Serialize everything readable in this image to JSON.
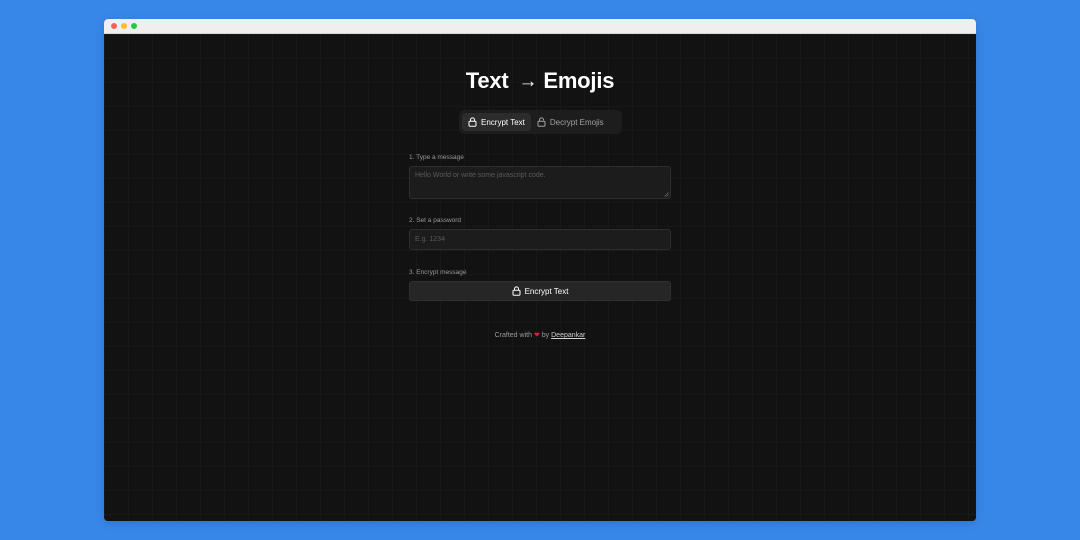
{
  "header": {
    "title_left": "Text",
    "title_arrow": "→",
    "title_right": "Emojis"
  },
  "tabs": [
    {
      "label": "Encrypt Text",
      "active": true,
      "icon": "lock-icon"
    },
    {
      "label": "Decrypt Emojis",
      "active": false,
      "icon": "unlock-icon"
    }
  ],
  "form": {
    "message_label": "1. Type a message",
    "message_placeholder": "Hello World or write some javascript code.",
    "message_value": "",
    "password_label": "2. Set a password",
    "password_placeholder": "E.g. 1234",
    "password_value": "",
    "encrypt_label": "3. Encrypt message",
    "encrypt_button": "Encrypt Text",
    "encrypt_button_icon": "lock-icon"
  },
  "footer": {
    "prefix": "Crafted with",
    "heart": "❤",
    "by": "by",
    "author": "Deepankar"
  },
  "colors": {
    "desktop": "#3787e8",
    "app_background": "#121212",
    "accent_heart": "#e11d48"
  }
}
